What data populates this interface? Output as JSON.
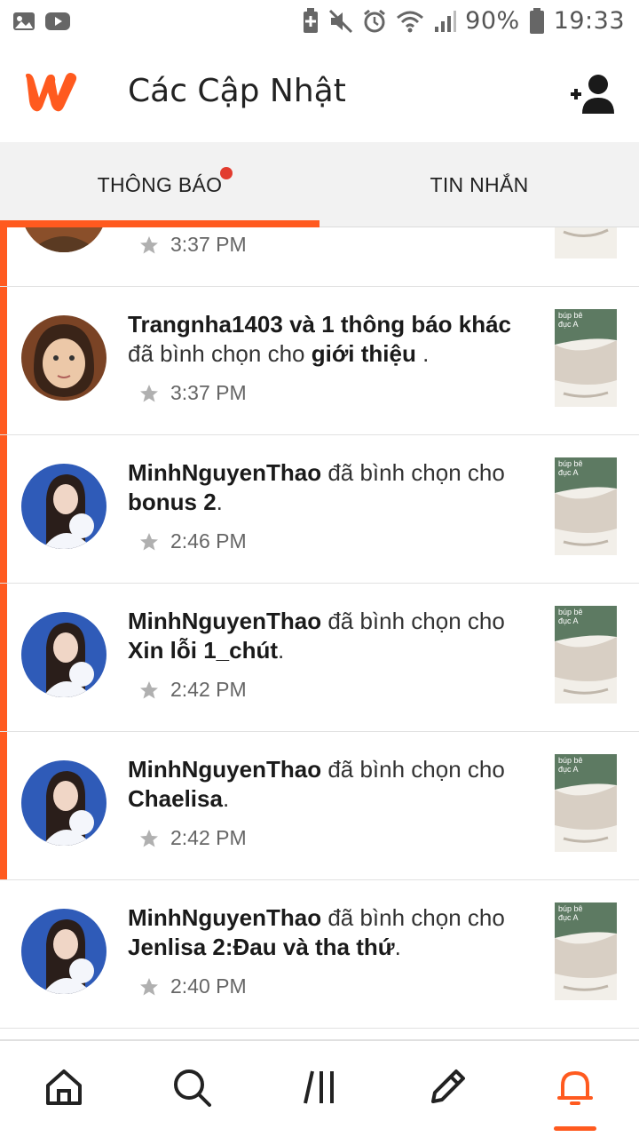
{
  "status_bar": {
    "battery_percent": "90%",
    "time": "19:33",
    "icons": [
      "gallery-icon",
      "youtube-icon",
      "battery-saver-icon",
      "mute-icon",
      "alarm-icon",
      "wifi-icon",
      "signal-icon",
      "battery-icon"
    ]
  },
  "header": {
    "title": "Các Cập Nhật",
    "logo": "wattpad-logo",
    "action_icon": "add-user-icon"
  },
  "tabs": [
    {
      "label": "THÔNG BÁO",
      "active": true,
      "has_badge": true
    },
    {
      "label": "TIN NHẮN",
      "active": false,
      "has_badge": false
    }
  ],
  "notifications": [
    {
      "actor": "",
      "text": "",
      "target": "",
      "time": "3:37 PM"
    },
    {
      "actor": "Trangnha1403 và 1 thông báo khác",
      "text": " đã bình chọn cho ",
      "target": "giới thiệu",
      "suffix": " .",
      "time": "3:37 PM"
    },
    {
      "actor": "MinhNguyenThao",
      "text": " đã bình chọn cho ",
      "target": "bonus 2",
      "suffix": ".",
      "time": "2:46 PM"
    },
    {
      "actor": "MinhNguyenThao",
      "text": " đã bình chọn cho ",
      "target": "Xin lỗi 1_chút",
      "suffix": ".",
      "time": "2:42 PM"
    },
    {
      "actor": "MinhNguyenThao",
      "text": " đã bình chọn cho ",
      "target": "Chaelisa",
      "suffix": ".",
      "time": "2:42 PM"
    },
    {
      "actor": "MinhNguyenThao",
      "text": " đã bình chọn cho ",
      "target": "Jenlisa 2:Đau và tha thứ",
      "suffix": ".",
      "time": "2:40 PM"
    }
  ],
  "thumb_text": "búp bê\nđục A",
  "bottom_nav": [
    "home-icon",
    "search-icon",
    "library-icon",
    "write-icon",
    "notifications-icon"
  ],
  "colors": {
    "accent": "#ff5a1f",
    "badge": "#e23b2e"
  }
}
